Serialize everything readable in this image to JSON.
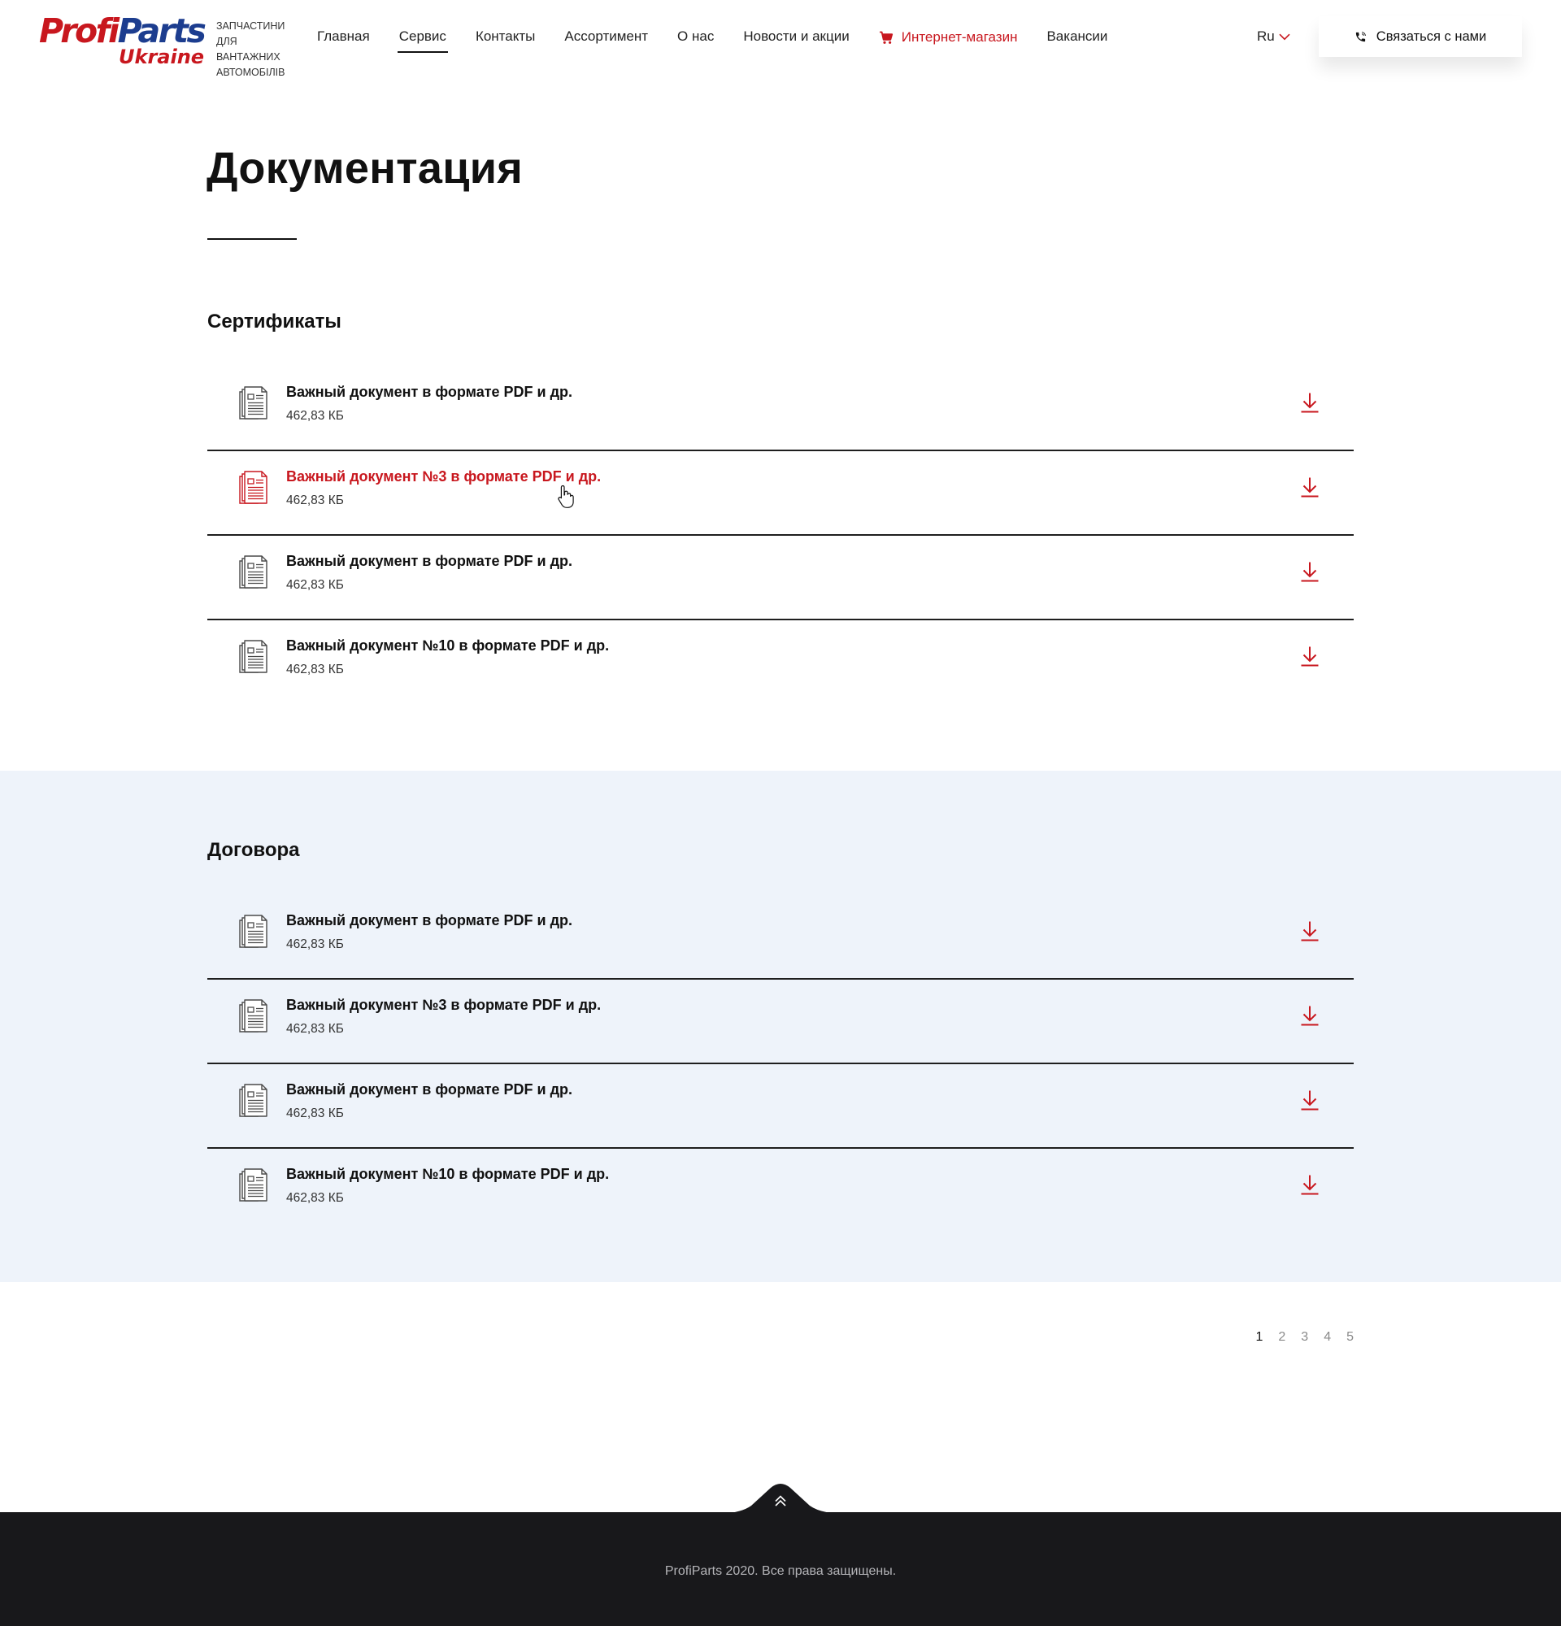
{
  "brand": {
    "name_part1": "Profi",
    "name_part2": "Parts",
    "country": "Ukraine",
    "tagline": [
      "Запчастини",
      "для вантажних",
      "автомобілів"
    ]
  },
  "nav": {
    "items": [
      {
        "label": "Главная"
      },
      {
        "label": "Сервис"
      },
      {
        "label": "Контакты"
      },
      {
        "label": "Ассортимент"
      },
      {
        "label": "О нас"
      },
      {
        "label": "Новости и акции"
      },
      {
        "label": "Интернет-магазин"
      },
      {
        "label": "Вакансии"
      }
    ],
    "active_item": "Сервис"
  },
  "language": {
    "current": "Ru"
  },
  "contact_button": {
    "label": "Связаться с нами"
  },
  "page": {
    "title": "Документация"
  },
  "sections": [
    {
      "heading": "Сертификаты",
      "documents": [
        {
          "name": "Важный документ в формате PDF и др.",
          "size": "462,83 КБ"
        },
        {
          "name": "Важный документ №3 в формате PDF и др.",
          "size": "462,83 КБ"
        },
        {
          "name": "Важный документ в формате PDF и др.",
          "size": "462,83 КБ"
        },
        {
          "name": "Важный документ №10 в формате PDF и др.",
          "size": "462,83 КБ"
        }
      ]
    },
    {
      "heading": "Договора",
      "documents": [
        {
          "name": "Важный документ в формате PDF и др.",
          "size": "462,83 КБ"
        },
        {
          "name": "Важный документ №3 в формате PDF и др.",
          "size": "462,83 КБ"
        },
        {
          "name": "Важный документ в формате PDF и др.",
          "size": "462,83 КБ"
        },
        {
          "name": "Важный документ №10 в формате PDF и др.",
          "size": "462,83 КБ"
        }
      ]
    }
  ],
  "hovered_document": "Важный документ №3 в формате PDF и др.",
  "icons": {
    "document": "document-icon",
    "download": "download-arrow-icon",
    "cart": "cart-icon",
    "phone": "phone-icon",
    "language_dropdown": "chevron-down-icon",
    "back_to_top": "double-chevron-up-icon",
    "pointer": "hand-cursor-icon"
  },
  "pagination": {
    "pages": [
      "1",
      "2",
      "3",
      "4",
      "5"
    ],
    "current": "1"
  },
  "footer": {
    "copyright": "ProfiParts 2020. Все права защищены."
  },
  "colors": {
    "accent": "#c8171e",
    "brand_blue": "#1c3d8f",
    "section_band": "#eef3fa",
    "footer_bg": "#18181b",
    "text": "#111111"
  }
}
